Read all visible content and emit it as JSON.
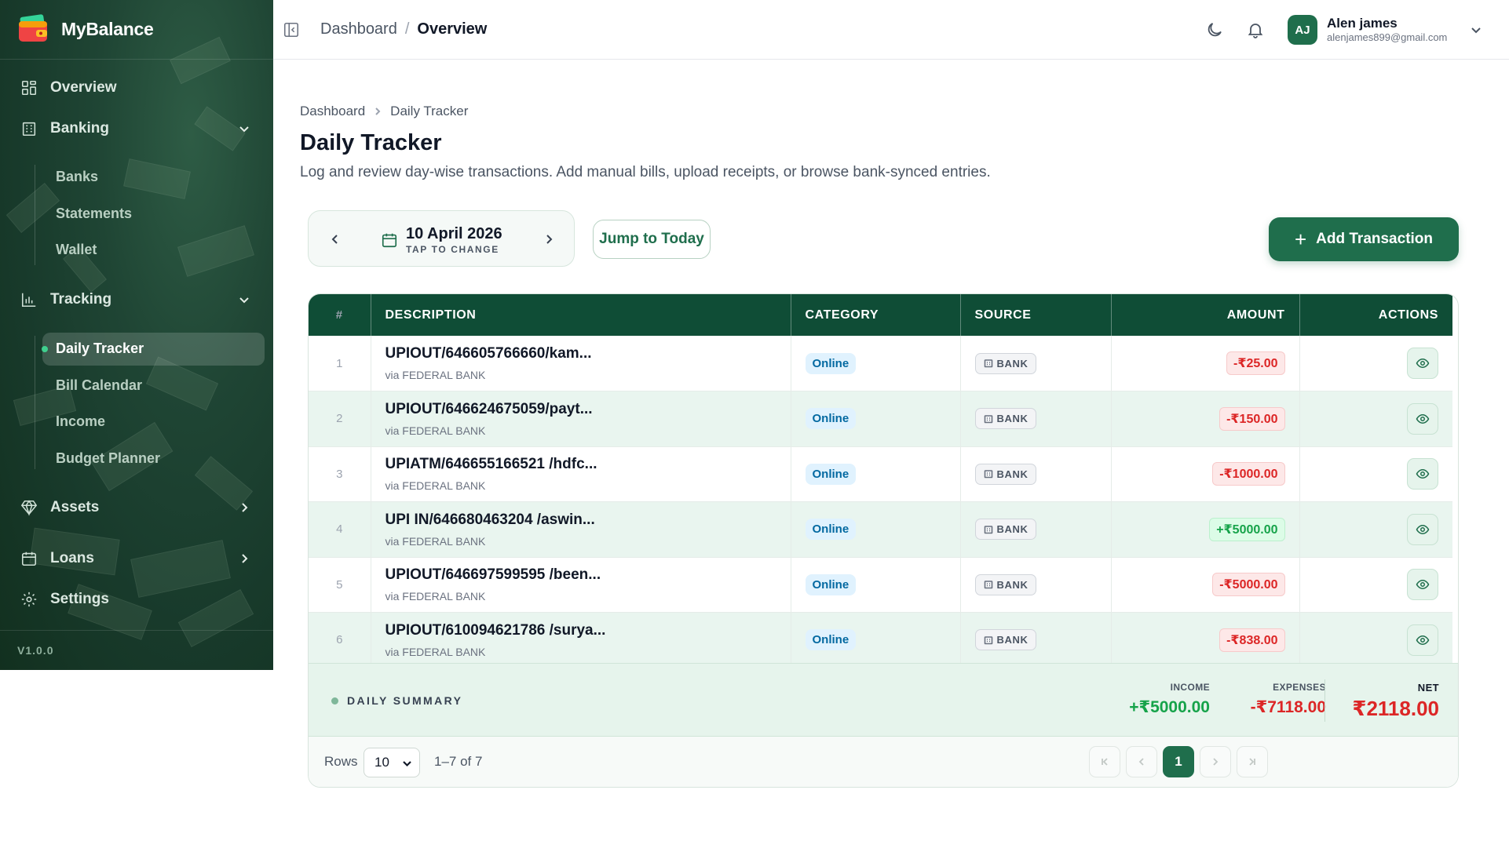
{
  "app": {
    "name": "MyBalance",
    "version": "V1.0.0"
  },
  "sidebar": {
    "overview": "Overview",
    "banking": {
      "label": "Banking",
      "items": [
        "Banks",
        "Statements",
        "Wallet"
      ]
    },
    "tracking": {
      "label": "Tracking",
      "items": [
        "Daily Tracker",
        "Bill Calendar",
        "Income",
        "Budget Planner"
      ],
      "active": "Daily Tracker"
    },
    "assets": "Assets",
    "loans": "Loans",
    "settings": "Settings"
  },
  "topbar": {
    "crumb_root": "Dashboard",
    "crumb_sep": "/",
    "crumb_current": "Overview",
    "user": {
      "initials": "AJ",
      "name": "Alen james",
      "email": "alenjames899@gmail.com"
    }
  },
  "page": {
    "breadcrumb": [
      "Dashboard",
      "Daily Tracker"
    ],
    "title": "Daily Tracker",
    "subtitle": "Log and review day-wise transactions. Add manual bills, upload receipts, or browse bank-synced entries."
  },
  "date_picker": {
    "date": "10 April 2026",
    "hint": "TAP TO CHANGE"
  },
  "buttons": {
    "jump_today": "Jump to Today",
    "add_transaction": "Add Transaction"
  },
  "table": {
    "columns": [
      "#",
      "DESCRIPTION",
      "CATEGORY",
      "SOURCE",
      "AMOUNT",
      "ACTIONS"
    ],
    "rows": [
      {
        "num": "1",
        "desc": "UPIOUT/646605766660/kam...",
        "via": "via FEDERAL BANK",
        "category": "Online",
        "source": "BANK",
        "amount": "-₹25.00",
        "type": "debit"
      },
      {
        "num": "2",
        "desc": "UPIOUT/646624675059/payt...",
        "via": "via FEDERAL BANK",
        "category": "Online",
        "source": "BANK",
        "amount": "-₹150.00",
        "type": "debit"
      },
      {
        "num": "3",
        "desc": "UPIATM/646655166521 /hdfc...",
        "via": "via FEDERAL BANK",
        "category": "Online",
        "source": "BANK",
        "amount": "-₹1000.00",
        "type": "debit"
      },
      {
        "num": "4",
        "desc": "UPI IN/646680463204 /aswin...",
        "via": "via FEDERAL BANK",
        "category": "Online",
        "source": "BANK",
        "amount": "+₹5000.00",
        "type": "credit"
      },
      {
        "num": "5",
        "desc": "UPIOUT/646697599595 /been...",
        "via": "via FEDERAL BANK",
        "category": "Online",
        "source": "BANK",
        "amount": "-₹5000.00",
        "type": "debit"
      },
      {
        "num": "6",
        "desc": "UPIOUT/610094621786 /surya...",
        "via": "via FEDERAL BANK",
        "category": "Online",
        "source": "BANK",
        "amount": "-₹838.00",
        "type": "debit"
      }
    ]
  },
  "summary": {
    "label": "DAILY SUMMARY",
    "income_label": "INCOME",
    "income": "+₹5000.00",
    "expenses_label": "EXPENSES",
    "expenses": "-₹7118.00",
    "net_label": "NET",
    "net": "₹2118.00"
  },
  "pagination": {
    "rows_label": "Rows",
    "rows_value": "10",
    "range": "1–7 of 7",
    "current_page": "1"
  },
  "colors": {
    "brand": "#1f6e4c",
    "header": "#0f4d36",
    "debit": "#dc2626",
    "credit": "#16a34a"
  }
}
